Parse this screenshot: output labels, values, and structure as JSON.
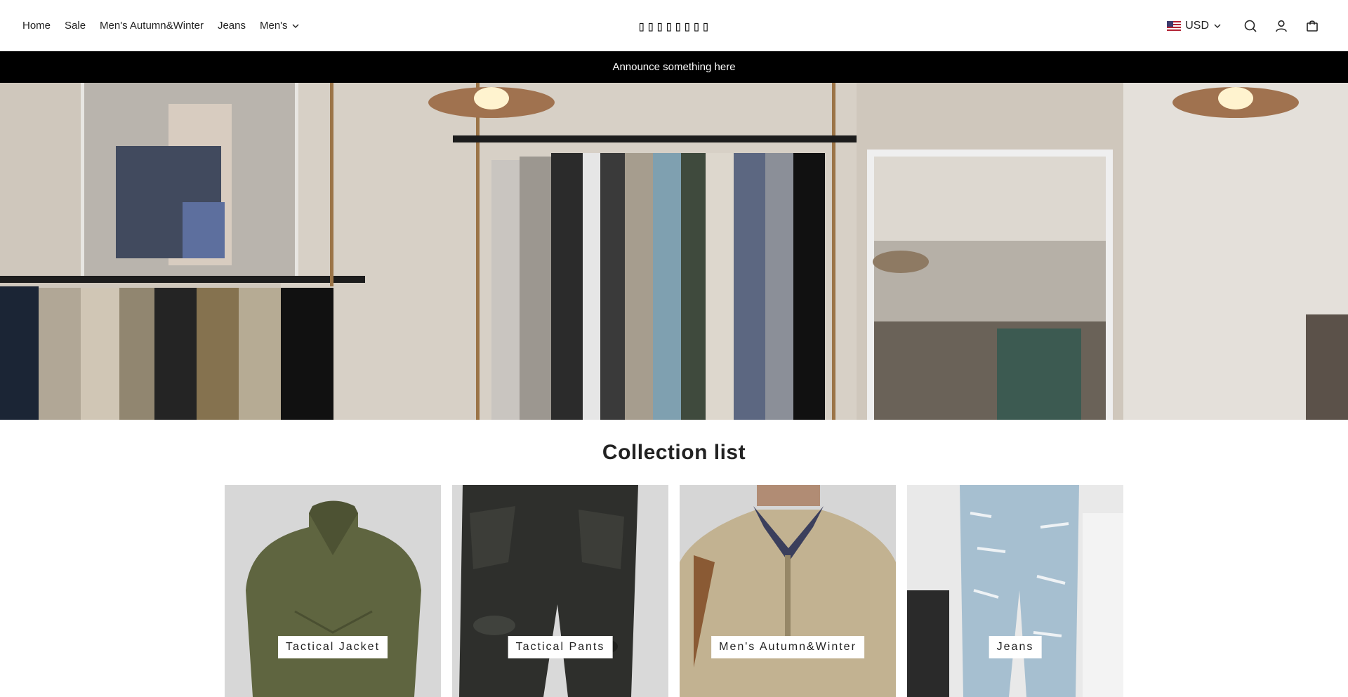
{
  "header": {
    "nav": [
      {
        "label": "Home"
      },
      {
        "label": "Sale"
      },
      {
        "label": "Men's Autumn&Winter"
      },
      {
        "label": "Jeans"
      },
      {
        "label": "Men's",
        "has_dropdown": true
      }
    ],
    "logo_text": "▯▯▯▯▯▯▯▯",
    "currency": "USD",
    "icons": [
      "search-icon",
      "account-icon",
      "cart-icon"
    ]
  },
  "announcement": {
    "text": "Announce something here"
  },
  "hero": {
    "image": "clothing-store-interior"
  },
  "collection": {
    "title": "Collection list",
    "items": [
      {
        "label": "Tactical Jacket"
      },
      {
        "label": "Tactical Pants"
      },
      {
        "label": "Men's Autumn&Winter"
      },
      {
        "label": "Jeans"
      }
    ]
  },
  "colors": {
    "announcement_bg": "#000000",
    "card_bg": "#d9d9d9"
  }
}
